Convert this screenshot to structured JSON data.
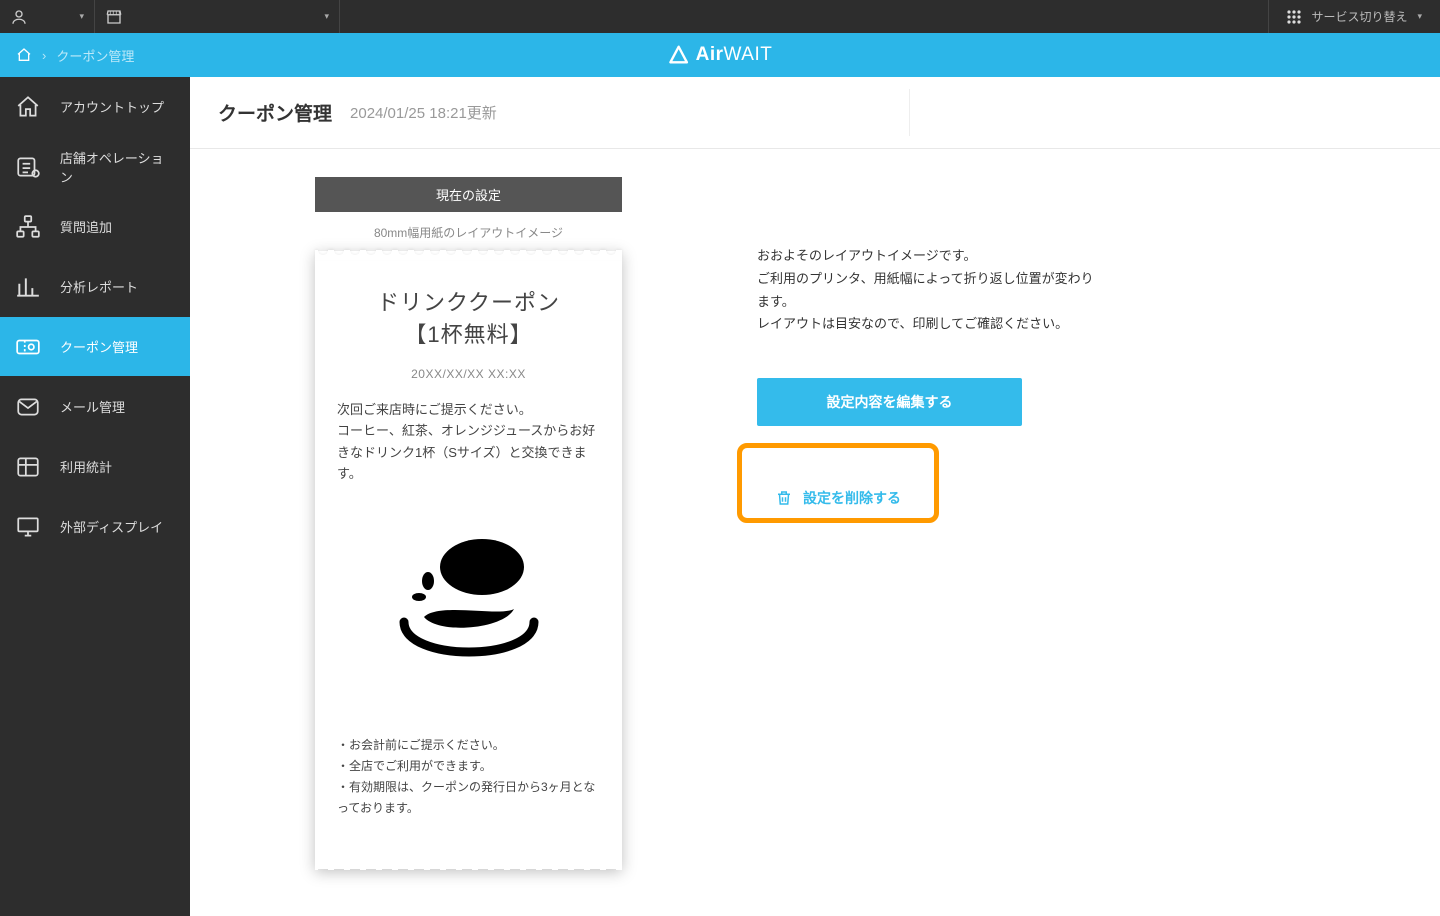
{
  "topbar": {
    "service_switch": "サービス切り替え"
  },
  "breadcrumb": {
    "current": "クーポン管理"
  },
  "brand": {
    "prefix": "Air",
    "suffix": "WAIT"
  },
  "sidebar": {
    "items": [
      {
        "label": "アカウントトップ"
      },
      {
        "label": "店舗オペレーション"
      },
      {
        "label": "質問追加"
      },
      {
        "label": "分析レポート"
      },
      {
        "label": "クーポン管理"
      },
      {
        "label": "メール管理"
      },
      {
        "label": "利用統計"
      },
      {
        "label": "外部ディスプレイ"
      }
    ]
  },
  "page": {
    "title": "クーポン管理",
    "updated": "2024/01/25 18:21更新",
    "tab_caption": "現在の設定",
    "sub_caption": "80mm幅用紙のレイアウトイメージ"
  },
  "coupon": {
    "title_line1": "ドリンククーポン",
    "title_line2": "【1杯無料】",
    "date": "20XX/XX/XX   XX:XX",
    "body_line1": "次回ご来店時にご提示ください。",
    "body_line2": "コーヒー、紅茶、オレンジジュースからお好きなドリンク1杯（Sサイズ）と交換できます。",
    "note1": "・お会計前にご提示ください。",
    "note2": "・全店でご利用ができます。",
    "note3": "・有効期限は、クーポンの発行日から3ヶ月となっております。"
  },
  "right": {
    "desc1": "おおよそのレイアウトイメージです。",
    "desc2": "ご利用のプリンタ、用紙幅によって折り返し位置が変わります。",
    "desc3": "レイアウトは目安なので、印刷してご確認ください。",
    "edit_label": "設定内容を編集する",
    "delete_label": "設定を削除する"
  }
}
